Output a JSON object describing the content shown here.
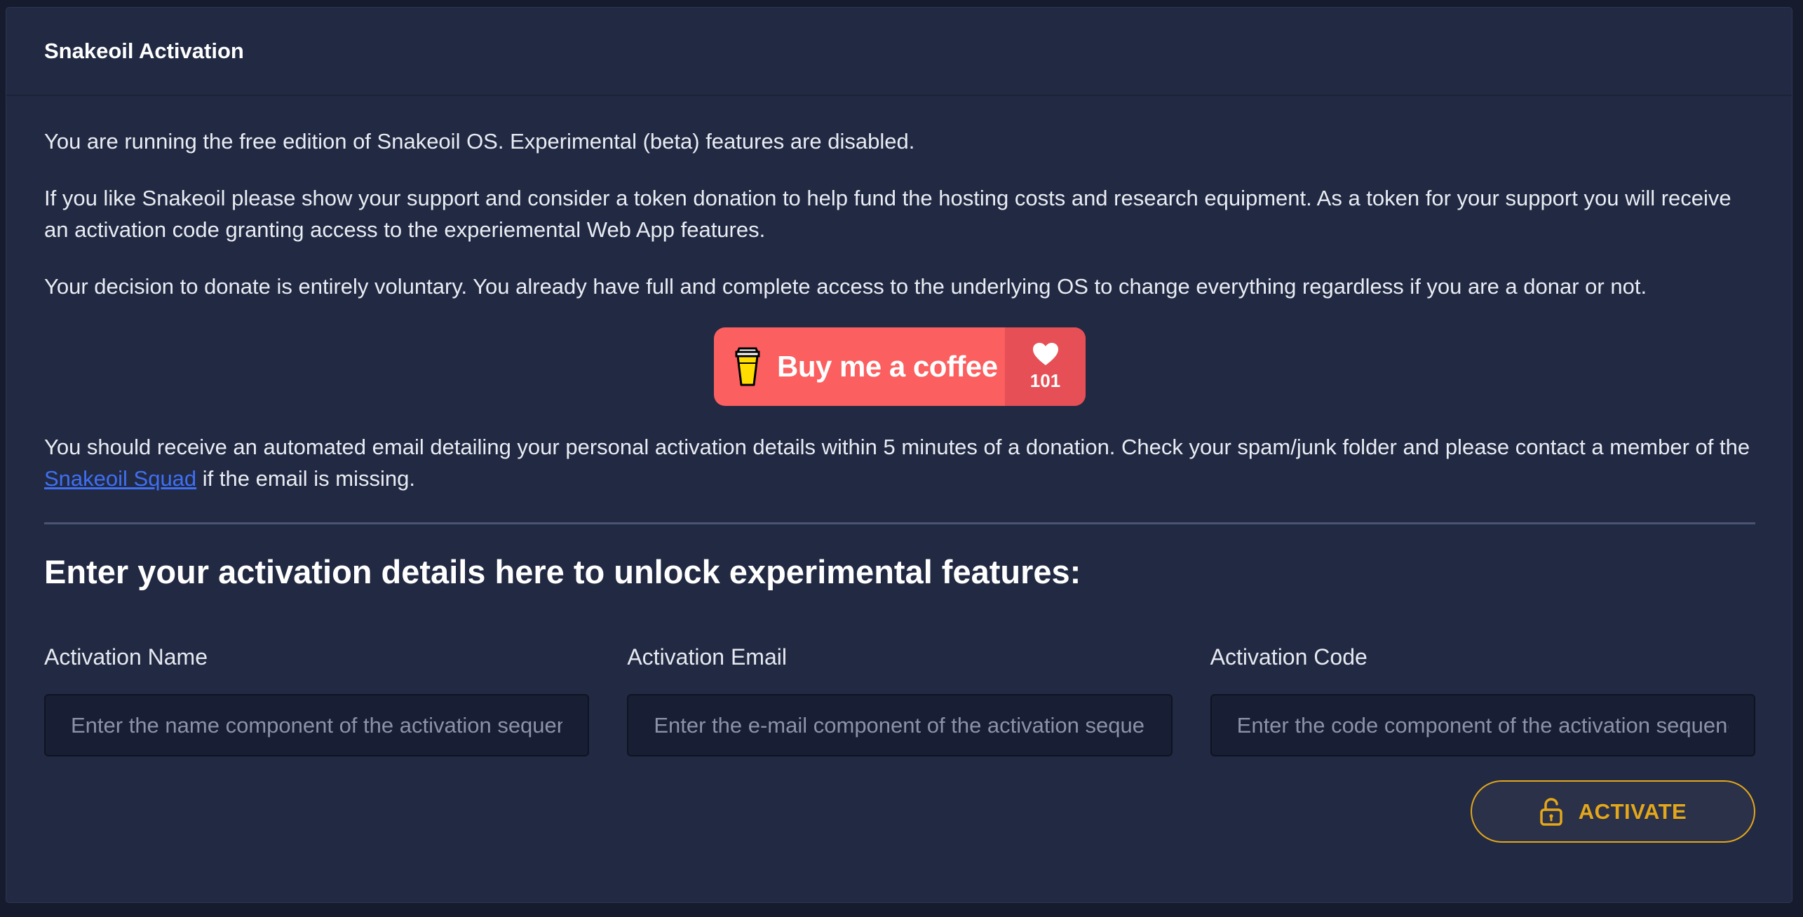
{
  "card": {
    "title": "Snakeoil Activation"
  },
  "intro": {
    "p1": "You are running the free edition of Snakeoil OS. Experimental (beta) features are disabled.",
    "p2": "If you like Snakeoil please show your support and consider a token donation to help fund the hosting costs and research equipment. As a token for your support you will receive an activation code granting access to the experiemental Web App features.",
    "p3": "Your decision to donate is entirely voluntary. You already have full and complete access to the underlying OS to change everything regardless if you are a donar or not."
  },
  "coffee": {
    "label": "Buy me a coffee",
    "count": "101",
    "icon": "coffee-cup-icon",
    "count_icon": "heart-icon",
    "color": "#fb5f5f"
  },
  "email_note": {
    "before": "You should receive an automated email detailing your personal activation details within 5 minutes of a donation. Check your spam/junk folder and please contact a member of the ",
    "link": "Snakeoil Squad",
    "after": " if the email is missing."
  },
  "form": {
    "title": "Enter your activation details here to unlock experimental features:",
    "name": {
      "label": "Activation Name",
      "placeholder": "Enter the name component of the activation sequence",
      "value": ""
    },
    "email": {
      "label": "Activation Email",
      "placeholder": "Enter the e-mail component of the activation sequence",
      "value": ""
    },
    "code": {
      "label": "Activation Code",
      "placeholder": "Enter the code component of the activation sequence",
      "value": ""
    },
    "activate_label": "ACTIVATE",
    "activate_icon": "unlock-icon",
    "accent": "#e4a71b"
  }
}
